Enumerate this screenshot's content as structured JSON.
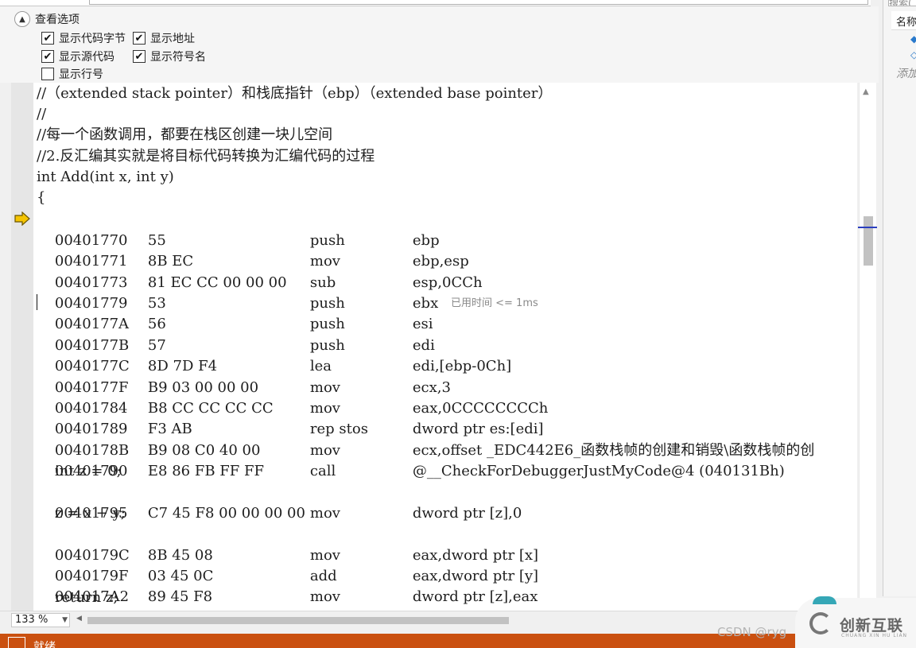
{
  "header": {
    "address_partial": ""
  },
  "options": {
    "title": "查看选项",
    "checkboxes": [
      {
        "label": "显示代码字节",
        "checked": true
      },
      {
        "label": "显示地址",
        "checked": true
      },
      {
        "label": "显示源代码",
        "checked": true
      },
      {
        "label": "显示符号名",
        "checked": true
      },
      {
        "label": "显示行号",
        "checked": false
      }
    ]
  },
  "right_panel": {
    "search_partial": "搜索(",
    "header_partial": "名称",
    "add_partial": "添加"
  },
  "code": {
    "source_lines": {
      "l1": "//（extended stack pointer）和栈底指针（ebp）（extended base pointer）",
      "l2": "//",
      "l3": "//每一个函数调用，都要在栈区创建一块儿空间",
      "l4": "//2.反汇编其实就是将目标代码转换为汇编代码的过程",
      "l5": "int Add(int x, int y)",
      "l6": "{",
      "l7": "    int z = 0;",
      "l8": "    z = x + y;",
      "l9": "    return z;"
    },
    "asm": [
      {
        "addr": "00401770",
        "bytes": "55",
        "mnem": "push",
        "ops": "ebp"
      },
      {
        "addr": "00401771",
        "bytes": "8B EC",
        "mnem": "mov",
        "ops": "ebp,esp"
      },
      {
        "addr": "00401773",
        "bytes": "81 EC CC 00 00 00",
        "mnem": "sub",
        "ops": "esp,0CCh"
      },
      {
        "addr": "00401779",
        "bytes": "53",
        "mnem": "push",
        "ops": "ebx"
      },
      {
        "addr": "0040177A",
        "bytes": "56",
        "mnem": "push",
        "ops": "esi"
      },
      {
        "addr": "0040177B",
        "bytes": "57",
        "mnem": "push",
        "ops": "edi"
      },
      {
        "addr": "0040177C",
        "bytes": "8D 7D F4",
        "mnem": "lea",
        "ops": "edi,[ebp-0Ch]"
      },
      {
        "addr": "0040177F",
        "bytes": "B9 03 00 00 00",
        "mnem": "mov",
        "ops": "ecx,3"
      },
      {
        "addr": "00401784",
        "bytes": "B8 CC CC CC CC",
        "mnem": "mov",
        "ops": "eax,0CCCCCCCCh"
      },
      {
        "addr": "00401789",
        "bytes": "F3 AB",
        "mnem": "rep stos",
        "ops": "dword ptr es:[edi]"
      },
      {
        "addr": "0040178B",
        "bytes": "B9 08 C0 40 00",
        "mnem": "mov",
        "ops": "ecx,offset _EDC442E6_函数栈帧的创建和销毁\\函数栈帧的创"
      },
      {
        "addr": "00401790",
        "bytes": "E8 86 FB FF FF",
        "mnem": "call",
        "ops": "@__CheckForDebuggerJustMyCode@4 (040131Bh)"
      },
      {
        "addr": "00401795",
        "bytes": "C7 45 F8 00 00 00 00",
        "mnem": "mov",
        "ops": "dword ptr [z],0"
      },
      {
        "addr": "0040179C",
        "bytes": "8B 45 08",
        "mnem": "mov",
        "ops": "eax,dword ptr [x]"
      },
      {
        "addr": "0040179F",
        "bytes": "03 45 0C",
        "mnem": "add",
        "ops": "eax,dword ptr [y]"
      },
      {
        "addr": "004017A2",
        "bytes": "89 45 F8",
        "mnem": "mov",
        "ops": "dword ptr [z],eax"
      }
    ],
    "elapsed_hint": "已用时间 <= 1ms"
  },
  "bottom": {
    "zoom": "133 %",
    "status": "就绪"
  },
  "overlay": {
    "watermark": "CSDN @ryg",
    "brand": "创新互联",
    "brand_sub": "CHUANG XIN HU LIAN"
  },
  "colors": {
    "status_bar": "#ca5010",
    "scroll_marker": "#2b3fbf",
    "arrow": "#f5c400"
  }
}
